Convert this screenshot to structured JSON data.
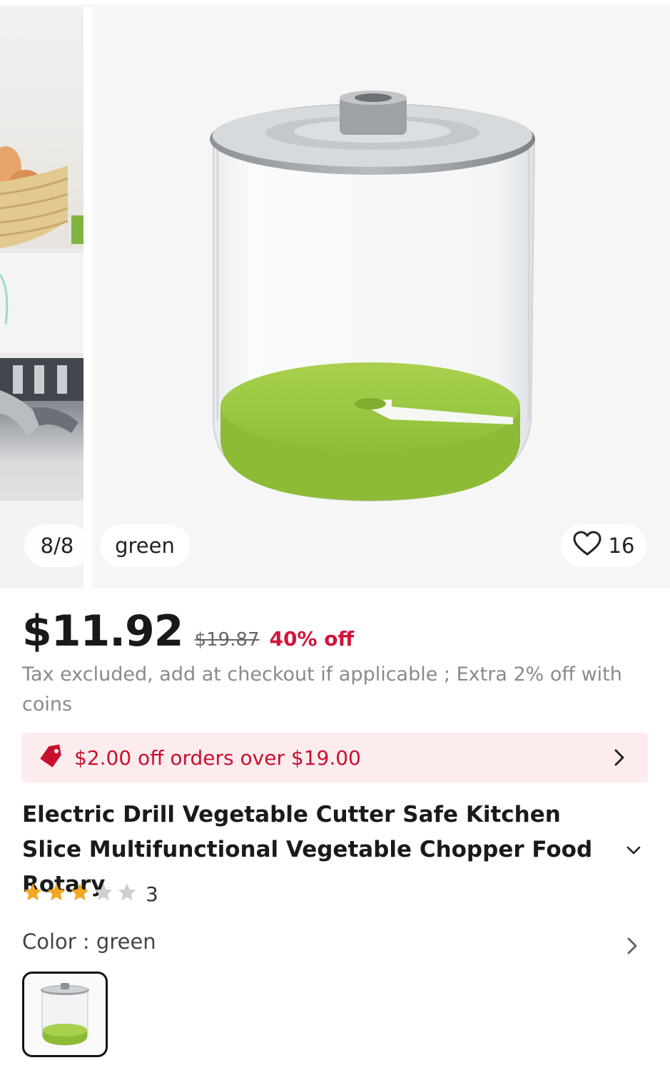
{
  "gallery": {
    "counter": "8/8",
    "color_label": "green",
    "wishlist_count": "16"
  },
  "pricing": {
    "price": "$11.92",
    "original_price": "$19.87",
    "discount": "40% off",
    "tax_note": "Tax excluded, add at checkout if applicable ; Extra 2% off with coins"
  },
  "coupon": {
    "text": "$2.00 off orders over $19.00"
  },
  "product": {
    "title": "Electric Drill Vegetable Cutter Safe Kitchen Slice Multifunctional Vegetable Chopper Food Rotary",
    "rating": 3,
    "rating_max": 5,
    "rating_count": "3"
  },
  "variant": {
    "color_label": "Color : green",
    "swatches": [
      "green"
    ]
  },
  "colors": {
    "accent": "#d2143c",
    "coupon_bg": "#fdecee",
    "star_filled": "#f5a623",
    "star_empty": "#d0d0d0",
    "product_green": "#9ccc3c"
  },
  "icons": {
    "wishlist": "heart-icon",
    "coupon": "tag-icon",
    "coupon_more": "chevron-right-icon",
    "title_expand": "chevron-down-icon",
    "color_more": "chevron-right-icon",
    "rating": "star-icon"
  }
}
